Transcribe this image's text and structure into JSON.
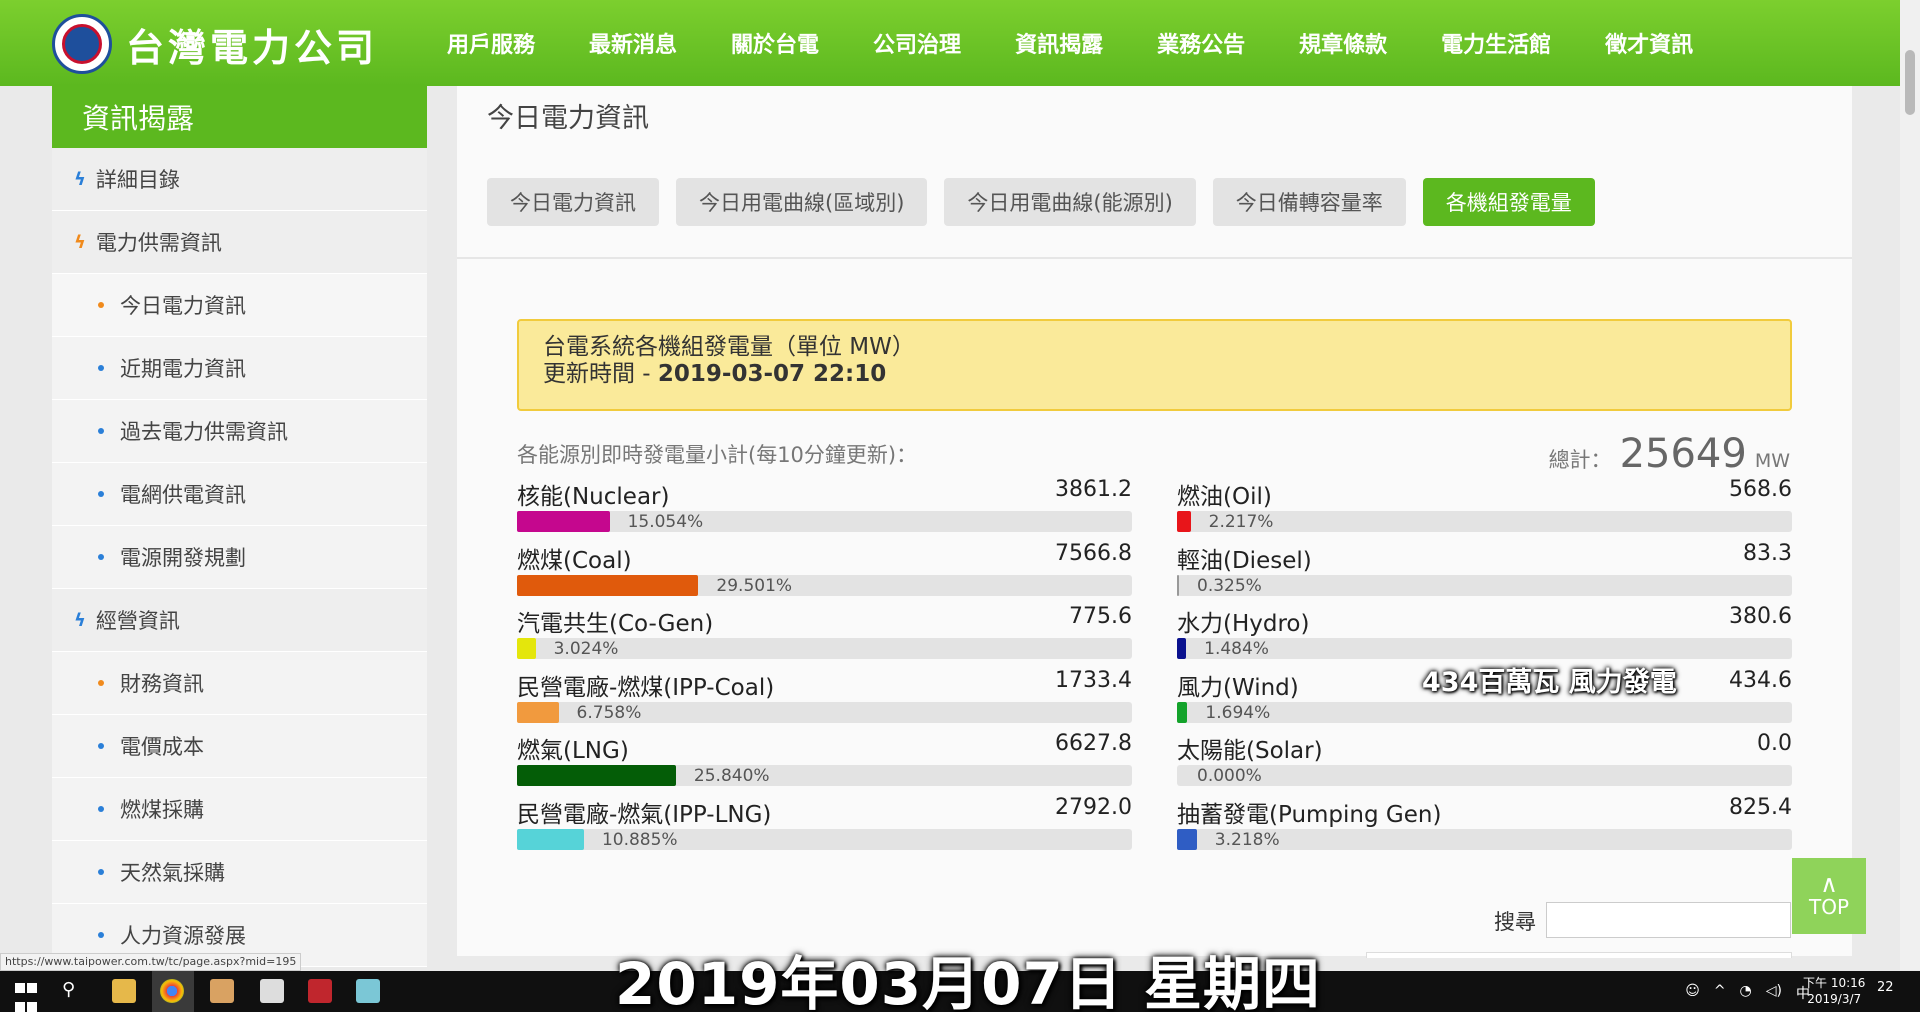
{
  "header": {
    "logo_text": "台灣電力公司",
    "nav": [
      "用戶服務",
      "最新消息",
      "關於台電",
      "公司治理",
      "資訊揭露",
      "業務公告",
      "規章條款",
      "電力生活館",
      "徵才資訊"
    ]
  },
  "sidebar": {
    "title": "資訊揭露",
    "items": [
      {
        "label": "詳細目錄"
      },
      {
        "label": "電力供需資訊"
      },
      {
        "label": "今日電力資訊"
      },
      {
        "label": "近期電力資訊"
      },
      {
        "label": "過去電力供需資訊"
      },
      {
        "label": "電網供電資訊"
      },
      {
        "label": "電源開發規劃"
      },
      {
        "label": "經營資訊"
      },
      {
        "label": "財務資訊"
      },
      {
        "label": "電價成本"
      },
      {
        "label": "燃煤採購"
      },
      {
        "label": "天然氣採購"
      },
      {
        "label": "人力資源發展"
      }
    ]
  },
  "main": {
    "page_title": "今日電力資訊",
    "tabs": [
      "今日電力資訊",
      "今日用電曲線(區域別)",
      "今日用電曲線(能源別)",
      "今日備轉容量率",
      "各機組發電量"
    ],
    "notice_line1": "台電系統各機組發電量（單位 MW）",
    "notice_line2_label": "更新時間 - ",
    "notice_line2_time": "2019-03-07 22:10",
    "subtitle": "各能源別即時發電量小計(每10分鐘更新)：",
    "total_label": "總計：",
    "total_value": "25649",
    "total_unit": "MW",
    "left_rows": [
      {
        "name": "核能(Nuclear)",
        "value": "3861.2",
        "pct": "15.054%",
        "pct_num": 15.054,
        "color": "#c5078e"
      },
      {
        "name": "燃煤(Coal)",
        "value": "7566.8",
        "pct": "29.501%",
        "pct_num": 29.501,
        "color": "#e05a0c"
      },
      {
        "name": "汽電共生(Co-Gen)",
        "value": "775.6",
        "pct": "3.024%",
        "pct_num": 3.024,
        "color": "#e4e60c"
      },
      {
        "name": "民營電廠-燃煤(IPP-Coal)",
        "value": "1733.4",
        "pct": "6.758%",
        "pct_num": 6.758,
        "color": "#f19a3e"
      },
      {
        "name": "燃氣(LNG)",
        "value": "6627.8",
        "pct": "25.840%",
        "pct_num": 25.84,
        "color": "#045d07"
      },
      {
        "name": "民營電廠-燃氣(IPP-LNG)",
        "value": "2792.0",
        "pct": "10.885%",
        "pct_num": 10.885,
        "color": "#56d3d8"
      }
    ],
    "right_rows": [
      {
        "name": "燃油(Oil)",
        "value": "568.6",
        "pct": "2.217%",
        "pct_num": 2.217,
        "color": "#e8151a"
      },
      {
        "name": "輕油(Diesel)",
        "value": "83.3",
        "pct": "0.325%",
        "pct_num": 0.325,
        "color": "#999999"
      },
      {
        "name": "水力(Hydro)",
        "value": "380.6",
        "pct": "1.484%",
        "pct_num": 1.484,
        "color": "#0a118e"
      },
      {
        "name": "風力(Wind)",
        "value": "434.6",
        "pct": "1.694%",
        "pct_num": 1.694,
        "color": "#14a32b"
      },
      {
        "name": "太陽能(Solar)",
        "value": "0.0",
        "pct": "0.000%",
        "pct_num": 0,
        "color": "#f0c80f"
      },
      {
        "name": "抽蓄發電(Pumping Gen)",
        "value": "825.4",
        "pct": "3.218%",
        "pct_num": 3.218,
        "color": "#2f5dc4"
      }
    ],
    "overlay_label": "434百萬瓦 風力發電",
    "search_label": "搜尋",
    "top_button_arrow": "∧",
    "top_button_label": "TOP"
  },
  "status_url": "https://www.taipower.com.tw/tc/page.aspx?mid=195",
  "taskbar": {
    "caption": "2019年03月07日 星期四",
    "clock_time": "下午 10:16",
    "clock_date": "2019/3/7",
    "notify_count": "22",
    "tray": [
      "中"
    ]
  }
}
